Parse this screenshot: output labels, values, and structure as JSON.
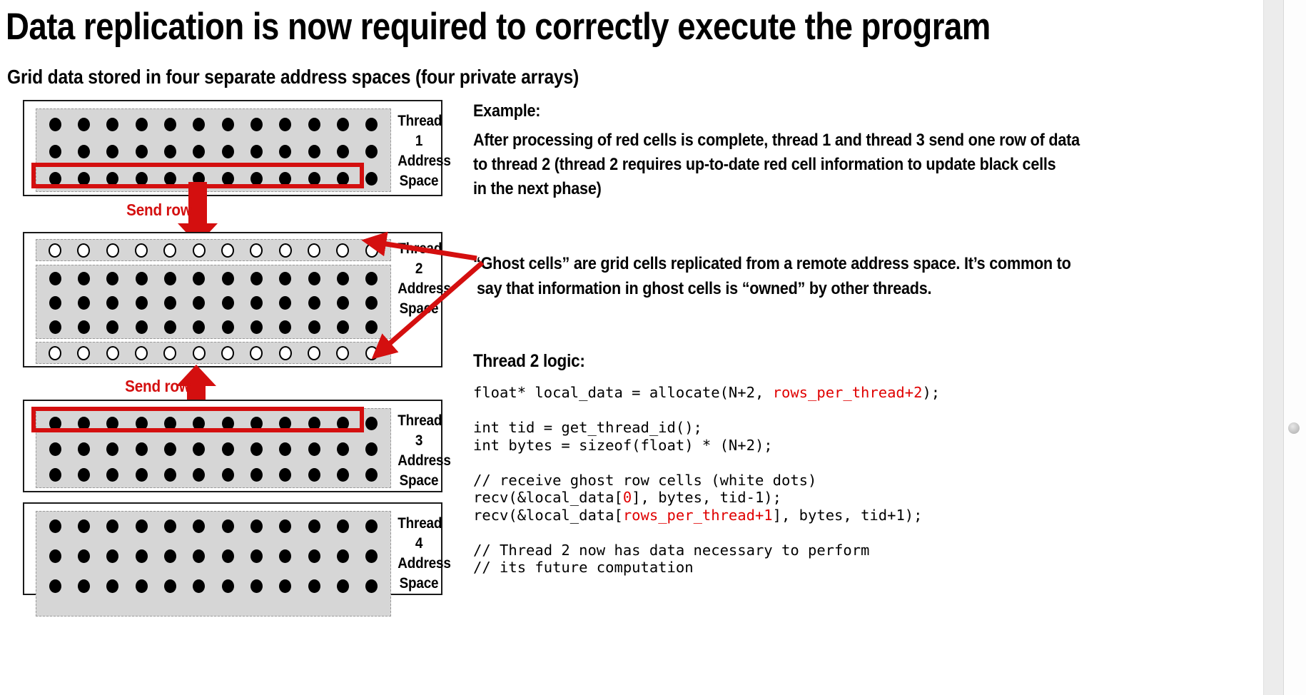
{
  "slide": {
    "title": "Data replication is now required to correctly execute the program",
    "subtitle": "Grid data stored in four separate address spaces (four private arrays)"
  },
  "colors": {
    "red_accent": "#d40f0f",
    "code_red": "#e00000",
    "grid_fill": "#d6d6d6",
    "grid_dash": "#9a9a9a",
    "box_border": "#1a1a1a",
    "text": "#000000"
  },
  "threads": [
    {
      "id": "thread-1",
      "label_line1": "Thread 1",
      "label_line2": "Address",
      "label_line3": "Space",
      "rows": [
        {
          "type": "normal",
          "cells": 12,
          "highlighted": false
        },
        {
          "type": "normal",
          "cells": 12,
          "highlighted": false
        },
        {
          "type": "normal",
          "cells": 12,
          "highlighted": true
        }
      ]
    },
    {
      "id": "thread-2",
      "label_line1": "Thread 2",
      "label_line2": "Address",
      "label_line3": "Space",
      "rows": [
        {
          "type": "ghost",
          "cells": 12,
          "highlighted": false
        },
        {
          "type": "normal",
          "cells": 12,
          "highlighted": false
        },
        {
          "type": "normal",
          "cells": 12,
          "highlighted": false
        },
        {
          "type": "normal",
          "cells": 12,
          "highlighted": false
        },
        {
          "type": "ghost",
          "cells": 12,
          "highlighted": false
        }
      ]
    },
    {
      "id": "thread-3",
      "label_line1": "Thread 3",
      "label_line2": "Address",
      "label_line3": "Space",
      "rows": [
        {
          "type": "normal",
          "cells": 12,
          "highlighted": true
        },
        {
          "type": "normal",
          "cells": 12,
          "highlighted": false
        },
        {
          "type": "normal",
          "cells": 12,
          "highlighted": false
        }
      ]
    },
    {
      "id": "thread-4",
      "label_line1": "Thread 4",
      "label_line2": "Address",
      "label_line3": "Space",
      "rows": [
        {
          "type": "normal",
          "cells": 12,
          "highlighted": false
        },
        {
          "type": "normal",
          "cells": 12,
          "highlighted": false
        },
        {
          "type": "normal",
          "cells": 12,
          "highlighted": false
        }
      ]
    }
  ],
  "arrows": {
    "send_row_top_label": "Send row",
    "send_row_bottom_label": "Send row"
  },
  "example": {
    "heading": "Example:",
    "line1": "After processing of red cells is complete, thread 1 and thread 3 send one row of data",
    "line2": "to thread 2 (thread 2 requires up-to-date red cell information to update black cells",
    "line3": "in the next phase)"
  },
  "ghost_note": {
    "line1": "“Ghost cells” are grid cells replicated from a remote address space.  It’s common to",
    "line2": "say that information in ghost cells is “owned” by other threads."
  },
  "code": {
    "heading": "Thread 2 logic:",
    "lines": [
      [
        {
          "t": "float* local_data = allocate(N+2, ",
          "c": "black"
        },
        {
          "t": "rows_per_thread+2",
          "c": "red"
        },
        {
          "t": ");",
          "c": "black"
        }
      ],
      [
        {
          "t": "",
          "c": "black"
        }
      ],
      [
        {
          "t": "int tid = get_thread_id();",
          "c": "black"
        }
      ],
      [
        {
          "t": "int bytes = sizeof(float) * (N+2);",
          "c": "black"
        }
      ],
      [
        {
          "t": "",
          "c": "black"
        }
      ],
      [
        {
          "t": "// receive ghost row cells (white dots)",
          "c": "black"
        }
      ],
      [
        {
          "t": "recv(&local_data[",
          "c": "black"
        },
        {
          "t": "0",
          "c": "red"
        },
        {
          "t": "], bytes, tid-1);",
          "c": "black"
        }
      ],
      [
        {
          "t": "recv(&local_data[",
          "c": "black"
        },
        {
          "t": "rows_per_thread+1",
          "c": "red"
        },
        {
          "t": "], bytes, tid+1);",
          "c": "black"
        }
      ],
      [
        {
          "t": "",
          "c": "black"
        }
      ],
      [
        {
          "t": "// Thread 2 now has data necessary to perform",
          "c": "black"
        }
      ],
      [
        {
          "t": "// its future computation",
          "c": "black"
        }
      ]
    ]
  },
  "scrollbar": {
    "thumb_label": "scroll-thumb"
  }
}
